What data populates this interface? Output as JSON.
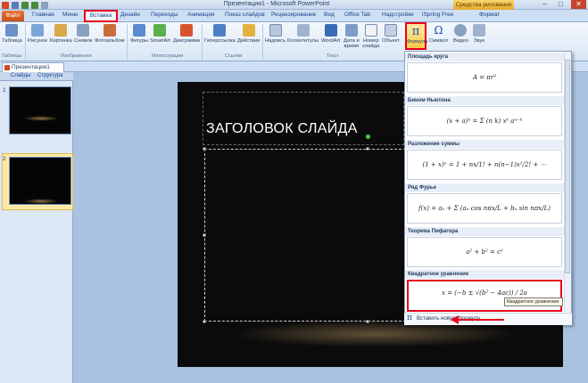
{
  "window": {
    "title": "Презентация1 - Microsoft PowerPoint",
    "drawing_tools": "Средства рисования"
  },
  "ribbon_tabs": {
    "file": "Файл",
    "home": "Главная",
    "menu": "Меню",
    "insert": "Вставка",
    "design": "Дизайн",
    "transitions": "Переходы",
    "animation": "Анимация",
    "slideshow": "Показ слайдов",
    "review": "Рецензирование",
    "view": "Вид",
    "officetab": "Office Tab",
    "addins": "Надстройки",
    "ispring": "iSpring Free",
    "format": "Формат"
  },
  "ribbon": {
    "buttons": {
      "table": "Таблица",
      "picture": "Рисунок",
      "clipart": "Картинка",
      "screenshot": "Снимок",
      "photoalbum": "Фотоальбом",
      "shapes": "Фигуры",
      "smartart": "SmartArt",
      "chart": "Диаграмма",
      "hyperlink": "Гиперссылка",
      "action": "Действие",
      "textbox": "Надпись",
      "headerfooter": "Колонтитулы",
      "wordart": "WordArt",
      "datetime_1": "Дата и",
      "datetime_2": "время",
      "slidenum_1": "Номер",
      "slidenum_2": "слайда",
      "object": "Объект",
      "formula": "Формула",
      "symbol": "Символ",
      "video": "Видео",
      "audio": "Звук"
    },
    "groups": {
      "tables": "Таблицы",
      "images": "Изображения",
      "illustrations": "Иллюстрации",
      "links": "Ссылки",
      "text": "Текст"
    }
  },
  "document": {
    "tab_label": "Презентация1"
  },
  "left_panel": {
    "tab_slides": "Слайды",
    "tab_outline": "Структура",
    "slide_numbers": [
      "1",
      "2"
    ]
  },
  "slide": {
    "title": "ЗАГОЛОВОК СЛАЙДА"
  },
  "formula_gallery": {
    "items": [
      {
        "name": "Площадь круга",
        "formula": "A = πr²"
      },
      {
        "name": "Бином Ньютона",
        "formula": "(x + a)ⁿ = Σ (n k) xᵏ aⁿ⁻ᵏ"
      },
      {
        "name": "Разложение суммы",
        "formula": "(1 + x)ⁿ = 1 + nx/1! + n(n−1)x²/2! + ⋯"
      },
      {
        "name": "Ряд Фурье",
        "formula": "f(x) = a₀ + Σ (aₙ cos nπx/L + bₙ sin nπx/L)"
      },
      {
        "name": "Теорема Пифагора",
        "formula": "a² + b² = c²"
      },
      {
        "name": "Квадратное уравнение",
        "formula": "x = (−b ± √(b² − 4ac)) / 2a"
      }
    ],
    "tooltip": "Квадратное уравнение",
    "insert_new": "Вставить новую формулу"
  },
  "colors": {
    "highlight_red": "#e8001c",
    "file_tab": "#d9602a",
    "drawing_tools": "#f0b93a"
  }
}
